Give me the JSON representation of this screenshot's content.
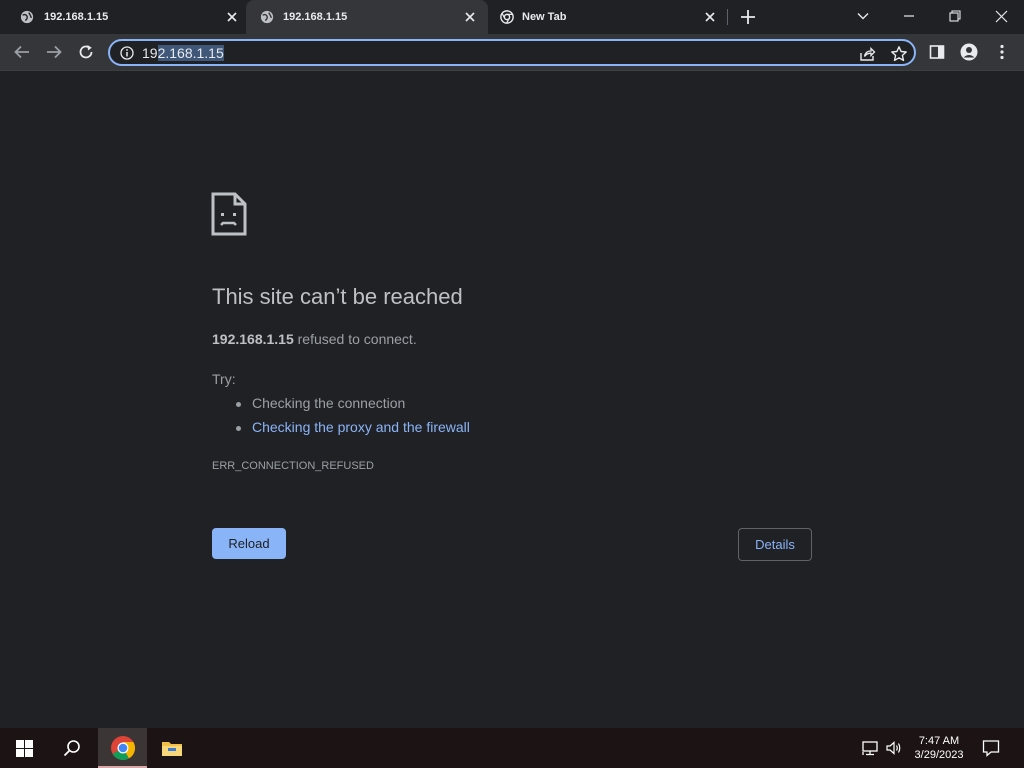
{
  "tabs": [
    {
      "title": "192.168.1.15",
      "favicon": "globe-icon",
      "active": false
    },
    {
      "title": "192.168.1.15",
      "favicon": "globe-icon",
      "active": true
    },
    {
      "title": "New Tab",
      "favicon": "chrome-icon",
      "active": false
    }
  ],
  "omnibox": {
    "url_prefix": "19",
    "url_selected": "2.168.1.15"
  },
  "error_page": {
    "icon": "sad-page-icon",
    "heading": "This site can’t be reached",
    "host": "192.168.1.15",
    "message": " refused to connect.",
    "try_label": "Try:",
    "suggestions": [
      {
        "text": "Checking the connection",
        "link": false
      },
      {
        "text": "Checking the proxy and the firewall",
        "link": true
      }
    ],
    "error_code": "ERR_CONNECTION_REFUSED",
    "reload_label": "Reload",
    "details_label": "Details"
  },
  "taskbar": {
    "time": "7:47 AM",
    "date": "3/29/2023",
    "pinned": [
      "windows-start-icon",
      "search-icon",
      "chrome-icon",
      "file-explorer-icon"
    ]
  },
  "colors": {
    "accent": "#8ab4f8",
    "page_bg": "#202124",
    "toolbar_bg": "#35363a"
  }
}
